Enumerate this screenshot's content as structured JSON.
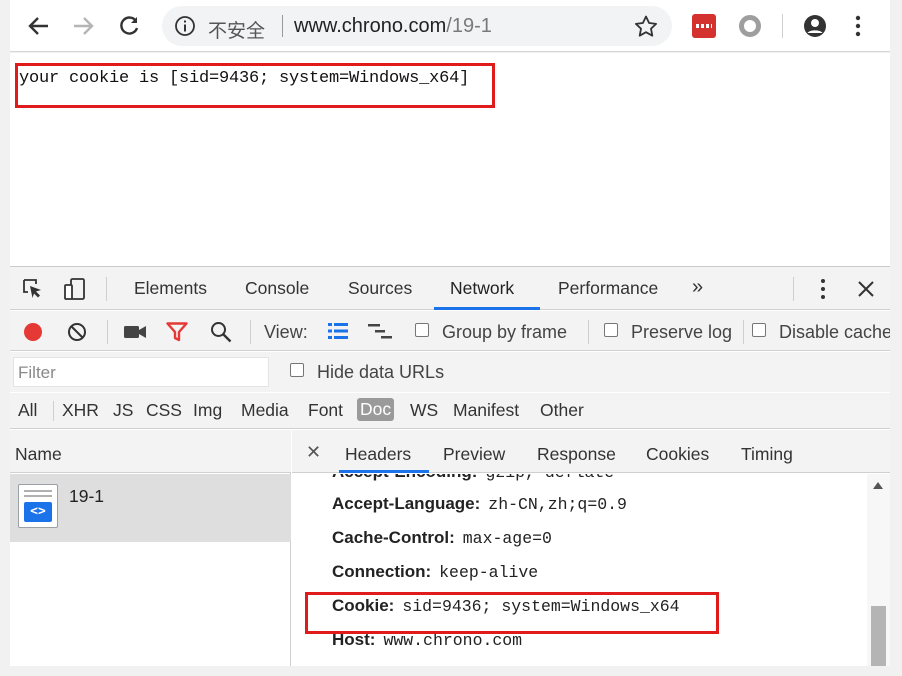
{
  "browser": {
    "security_label": "不安全",
    "url_host": "www.chrono.com",
    "url_path": "/19-1"
  },
  "page": {
    "text": "your cookie is [sid=9436; system=Windows_x64]"
  },
  "devtools": {
    "tabs": [
      "Elements",
      "Console",
      "Sources",
      "Network",
      "Performance"
    ],
    "active_tab": "Network",
    "more_tabs": "»",
    "controls": {
      "view_label": "View:",
      "group_by_frame": "Group by frame",
      "preserve_log": "Preserve log",
      "disable_cache": "Disable cache"
    },
    "filter": {
      "placeholder": "Filter",
      "hide_data_urls": "Hide data URLs"
    },
    "types": [
      "All",
      "XHR",
      "JS",
      "CSS",
      "Img",
      "Media",
      "Font",
      "Doc",
      "WS",
      "Manifest",
      "Other"
    ],
    "selected_type": "Doc",
    "name_header": "Name",
    "requests": [
      {
        "name": "19-1"
      }
    ],
    "detail_tabs": [
      "Headers",
      "Preview",
      "Response",
      "Cookies",
      "Timing"
    ],
    "active_detail_tab": "Headers",
    "headers": [
      {
        "key": "Accept-Encoding:",
        "value": "gzip, deflate"
      },
      {
        "key": "Accept-Language:",
        "value": "zh-CN,zh;q=0.9"
      },
      {
        "key": "Cache-Control:",
        "value": "max-age=0"
      },
      {
        "key": "Connection:",
        "value": "keep-alive"
      },
      {
        "key": "Cookie:",
        "value": "sid=9436; system=Windows_x64"
      },
      {
        "key": "Host:",
        "value": "www.chrono.com"
      }
    ]
  },
  "colors": {
    "highlight_box": "#e01b1b",
    "accent": "#1a73e8",
    "record": "#e53935",
    "filter_active": "#e53935"
  }
}
